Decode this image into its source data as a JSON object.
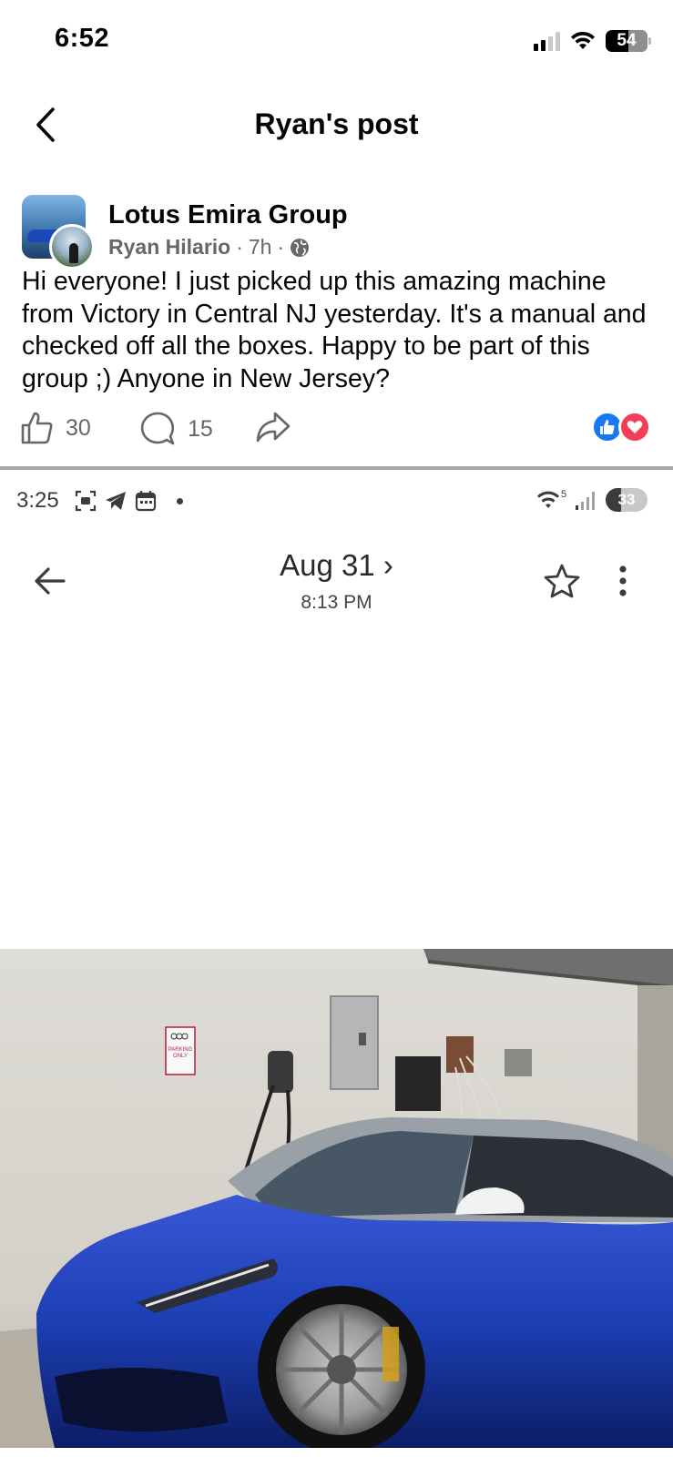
{
  "status_bar": {
    "time": "6:52",
    "battery": "54"
  },
  "header": {
    "title": "Ryan's post"
  },
  "post": {
    "group_name": "Lotus Emira Group",
    "author": "Ryan Hilario",
    "time": "7h",
    "separator": "·",
    "text": "Hi everyone! I just picked up this amazing machine from Victory in Central NJ yesterday. It's a manual and checked off all the boxes. Happy to be part of this group ;) Anyone in New Jersey?",
    "likes": "30",
    "comments": "15"
  },
  "embedded_screenshot": {
    "time": "3:25",
    "battery": "33",
    "wifi_label": "5",
    "date": "Aug 31",
    "date_chevron": "›",
    "timestamp": "8:13 PM",
    "parking_sign": {
      "line1": "PARKING",
      "line2": "ONLY"
    }
  },
  "colors": {
    "facebook_blue": "#1877f2",
    "love_red": "#f33e58",
    "car_blue": "#1d3fb4",
    "meta_gray": "#65676b"
  }
}
